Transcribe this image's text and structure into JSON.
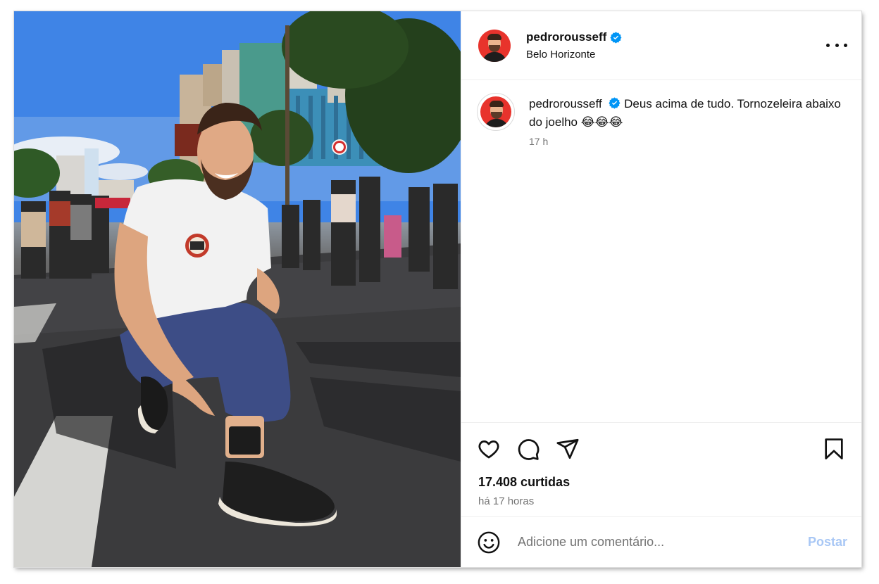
{
  "post": {
    "username": "pedrorousseff",
    "location": "Belo Horizonte",
    "caption_text": "Deus acima de tudo. Tornozeleira abaixo do joelho 😂😂😂",
    "caption_time": "17 h",
    "likes": "17.408 curtidas",
    "posted_time": "há 17 horas"
  },
  "comment_box": {
    "placeholder": "Adicione um comentário...",
    "post_label": "Postar"
  },
  "colors": {
    "verified_badge": "#0095f6",
    "post_button_disabled": "#a8c7f5",
    "secondary_text": "#737373"
  },
  "icons": {
    "header_more": "more-horizontal-icon",
    "like": "heart-icon",
    "comment": "comment-icon",
    "share": "paper-plane-icon",
    "save": "bookmark-icon",
    "emoji": "smiley-icon",
    "verified": "verified-badge-icon"
  }
}
